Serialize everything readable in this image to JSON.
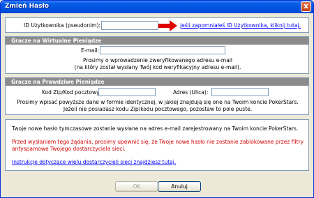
{
  "window": {
    "title": "Zmień Hasło",
    "close_glyph": "x"
  },
  "user_id": {
    "label": "ID Użytkownika (pseudonim):",
    "value": "",
    "forgot_link": "jeśli zapomniałeś ID Użytkownika, kliknij tutaj."
  },
  "virtual_money": {
    "header": "Gracze na Wirtualne Pieniądze",
    "email_label": "E-mail:",
    "email_value": "",
    "note_line1": "Prosimy o wprowadzenie zweryfikowanego adresu e-mail",
    "note_line2": "(na który został wysłany Twój kod weryfikacyjny adresu e-mail)."
  },
  "real_money": {
    "header": "Gracze na Prawdziwe Pieniądze",
    "zip_label": "Kod Zip/Kod pocztowy:",
    "zip_value": "",
    "address_label": "Adres (Ulica):",
    "address_value": "",
    "note_line1": "Prosimy wpisać powyższe dane w formie identycznej, w jakiej znajdują się one na Twoim koncie PokerStars.",
    "note_line2": "Jeżeli nie posiadasz kodu Zip/kodu pocztowego, pozostaw to pole puste."
  },
  "info": {
    "line1": "Twoje nowe hasło tymczasowe zostanie wysłane na adres e-mail zarejestrowany na Twoim koncie PokerStars.",
    "warning_line1": "Przed wysłaniem tego żądania, prosimy upewnić się, że Twoje nowe hasło nie zostanie zablokowane przez filtry",
    "warning_line2": "antyspamowe Twojego dostarczyciela sieci.",
    "instructions_link": "Instrukcje dotyczące wielu dostarczycieli sieci znajdziesz tutaj."
  },
  "buttons": {
    "ok": "OK",
    "cancel": "Anuluj"
  },
  "colors": {
    "title_bar": "#0053e1",
    "arrow": "#e00000",
    "link": "#0000ff",
    "warning": "#d40000"
  }
}
